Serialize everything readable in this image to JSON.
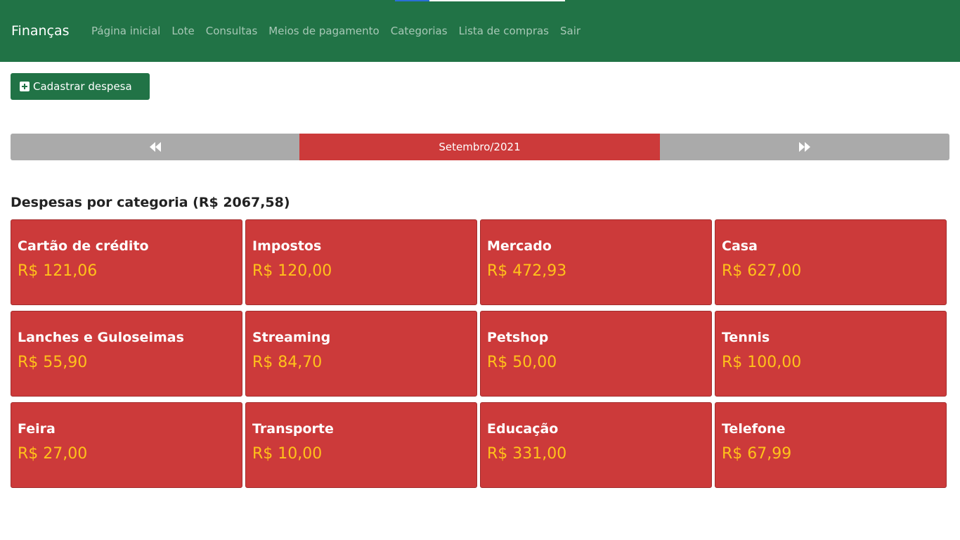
{
  "navbar": {
    "brand": "Finanças",
    "links": [
      "Página inicial",
      "Lote",
      "Consultas",
      "Meios de pagamento",
      "Categorias",
      "Lista de compras",
      "Sair"
    ]
  },
  "actions": {
    "add_expense_label": "Cadastrar despesa"
  },
  "month_nav": {
    "prev_icon": "rewind-icon",
    "current_month": "Setembro/2021",
    "next_icon": "fast-forward-icon"
  },
  "section": {
    "title": "Despesas por categoria (R$ 2067,58)"
  },
  "categories": [
    {
      "name": "Cartão de crédito",
      "value": "R$ 121,06"
    },
    {
      "name": "Impostos",
      "value": "R$ 120,00"
    },
    {
      "name": "Mercado",
      "value": "R$ 472,93"
    },
    {
      "name": "Casa",
      "value": "R$ 627,00"
    },
    {
      "name": "Lanches e Guloseimas",
      "value": "R$ 55,90"
    },
    {
      "name": "Streaming",
      "value": "R$ 84,70"
    },
    {
      "name": "Petshop",
      "value": "R$ 50,00"
    },
    {
      "name": "Tennis",
      "value": "R$ 100,00"
    },
    {
      "name": "Feira",
      "value": "R$ 27,00"
    },
    {
      "name": "Transporte",
      "value": "R$ 10,00"
    },
    {
      "name": "Educação",
      "value": "R$ 331,00"
    },
    {
      "name": "Telefone",
      "value": "R$ 67,99"
    }
  ],
  "colors": {
    "navbar": "#217346",
    "card": "#cc3a3a",
    "value_text": "#ffc21a",
    "nav_button": "#aaaaaa"
  }
}
